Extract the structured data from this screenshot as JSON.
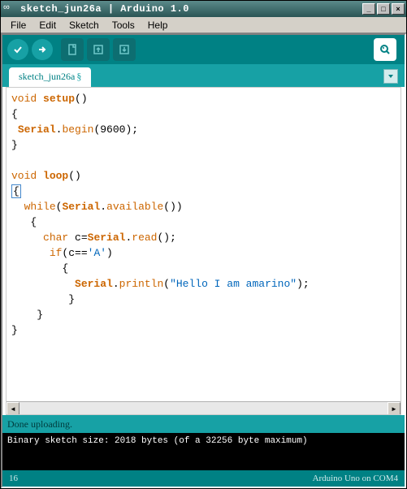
{
  "titlebar": {
    "text": "sketch_jun26a | Arduino 1.0"
  },
  "menu": {
    "file": "File",
    "edit": "Edit",
    "sketch": "Sketch",
    "tools": "Tools",
    "help": "Help"
  },
  "tab": {
    "name": "sketch_jun26a",
    "modified": "§"
  },
  "code": {
    "l1_void": "void",
    "l1_func": "setup",
    "l1_rest": "()",
    "l2": "{",
    "l3_a": " ",
    "l3_serial": "Serial",
    "l3_dot": ".",
    "l3_method": "begin",
    "l3_rest": "(9600);",
    "l4": "}",
    "l5": "",
    "l6_void": "void",
    "l6_func": "loop",
    "l6_rest": "()",
    "l7": "{",
    "l8_a": "  ",
    "l8_while": "while",
    "l8_b": "(",
    "l8_serial": "Serial",
    "l8_dot": ".",
    "l8_method": "available",
    "l8_rest": "())",
    "l9": "   {",
    "l10_a": "     ",
    "l10_char": "char",
    "l10_b": " c=",
    "l10_serial": "Serial",
    "l10_dot": ".",
    "l10_method": "read",
    "l10_rest": "();",
    "l11_a": "      ",
    "l11_if": "if",
    "l11_b": "(c==",
    "l11_str": "'A'",
    "l11_c": ")",
    "l12": "        {",
    "l13_a": "          ",
    "l13_serial": "Serial",
    "l13_dot": ".",
    "l13_method": "println",
    "l13_b": "(",
    "l13_str": "\"Hello I am amarino\"",
    "l13_c": ");",
    "l14": "         }",
    "l15": "    } ",
    "l16": "}"
  },
  "status": {
    "text": "Done uploading."
  },
  "console": {
    "line1": "Binary sketch size: 2018 bytes (of a 32256 byte maximum)"
  },
  "footer": {
    "line": "16",
    "board": "Arduino Uno on COM4"
  }
}
